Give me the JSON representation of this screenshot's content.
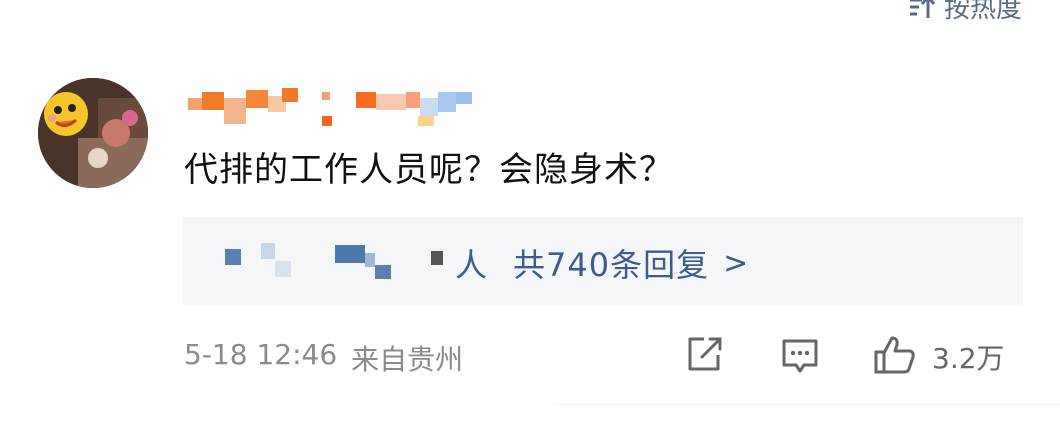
{
  "sort": {
    "label": "按热度",
    "icon": "sort-icon"
  },
  "comment": {
    "avatar_icon": "user-avatar",
    "username_obscured": true,
    "text": "代排的工作人员呢？会隐身术？",
    "reply_preview": {
      "suffix": "人",
      "count_label": "共740条回复",
      "chevron": ">"
    },
    "date": "5-18 12:46",
    "location": "来自贵州",
    "actions": {
      "share_icon": "share-icon",
      "comment_icon": "comment-icon",
      "like_icon": "thumbs-up-icon",
      "like_count": "3.2万"
    }
  }
}
